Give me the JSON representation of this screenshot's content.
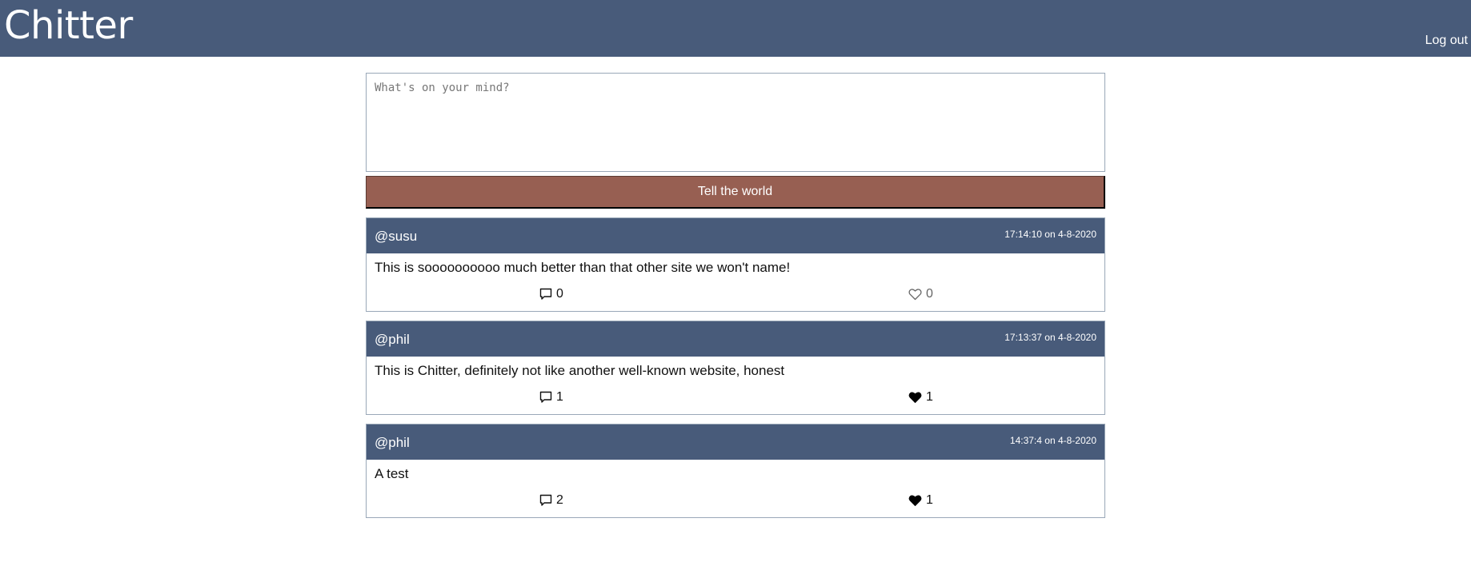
{
  "app": {
    "brand": "Chitter",
    "logout_label": "Log out"
  },
  "compose": {
    "placeholder": "What's on your mind?",
    "value": "",
    "submit_label": "Tell the world"
  },
  "peeps": [
    {
      "user": "@susu",
      "time": "17:14:10 on 4-8-2020",
      "text": "This is soooooooooo much better than that other site we won't name!",
      "comments": "0",
      "likes": "0",
      "liked": false
    },
    {
      "user": "@phil",
      "time": "17:13:37 on 4-8-2020",
      "text": "This is Chitter, definitely not like another well-known website, honest",
      "comments": "1",
      "likes": "1",
      "liked": true
    },
    {
      "user": "@phil",
      "time": "14:37:4 on 4-8-2020",
      "text": "A test",
      "comments": "2",
      "likes": "1",
      "liked": true
    }
  ],
  "colors": {
    "header": "#485b7a",
    "button": "#975f52"
  },
  "icons": {
    "comment": "speech-bubble-icon",
    "like_empty": "heart-outline-icon",
    "like_filled": "heart-filled-icon"
  }
}
